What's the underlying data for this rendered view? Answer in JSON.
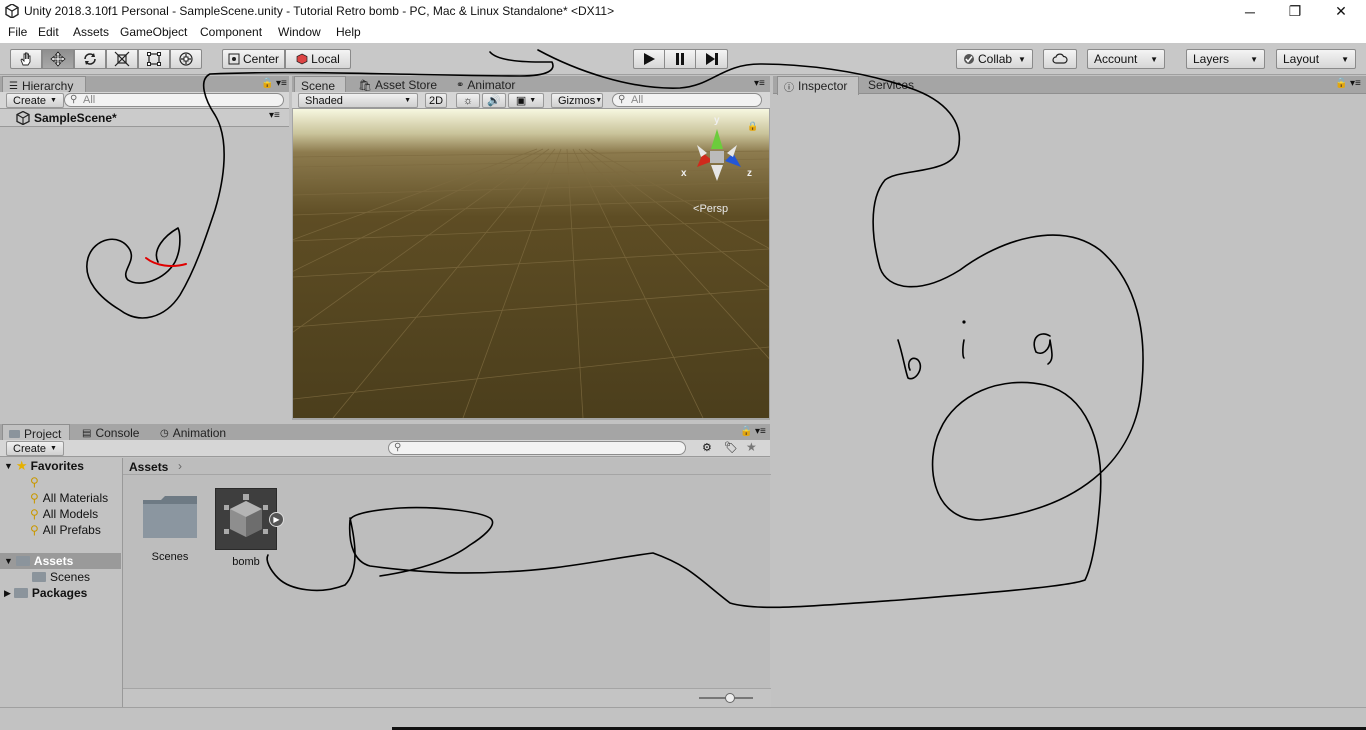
{
  "window": {
    "title": "Unity 2018.3.10f1 Personal - SampleScene.unity - Tutorial Retro bomb - PC, Mac & Linux Standalone* <DX11>",
    "minimize": "─",
    "maximize": "❐",
    "close": "✕"
  },
  "menu": [
    "File",
    "Edit",
    "Assets",
    "GameObject",
    "Component",
    "Window",
    "Help"
  ],
  "toolbar": {
    "tools": [
      "hand-tool",
      "move-tool",
      "rotate-tool",
      "scale-tool",
      "rect-tool",
      "transform-tool"
    ],
    "pivot": "Center",
    "space": "Local",
    "collab": "Collab",
    "account": "Account",
    "layers": "Layers",
    "layout": "Layout"
  },
  "hierarchy": {
    "tab": "Hierarchy",
    "create": "Create",
    "search_placeholder": "All",
    "scene": "SampleScene*"
  },
  "scene_tabs": {
    "scene": "Scene",
    "asset_store": "Asset Store",
    "animator": "Animator"
  },
  "scene_toolbar": {
    "shading": "Shaded",
    "mode_2d": "2D",
    "gizmos": "Gizmos",
    "search_placeholder": "All"
  },
  "gizmo": {
    "y": "y",
    "x": "x",
    "z": "z",
    "persp": "Persp"
  },
  "inspector": {
    "tab": "Inspector",
    "services": "Services"
  },
  "project": {
    "tabs": [
      "Project",
      "Console",
      "Animation"
    ],
    "create": "Create",
    "breadcrumb": "Assets",
    "favorites": {
      "label": "Favorites",
      "items": [
        "",
        "All Materials",
        "All Models",
        "All Prefabs"
      ]
    },
    "assets_label": "Assets",
    "scenes_label": "Scenes",
    "packages_label": "Packages",
    "grid": [
      {
        "name": "Scenes",
        "kind": "folder"
      },
      {
        "name": "bomb",
        "kind": "model"
      }
    ]
  },
  "drawing": {
    "text": "big",
    "stroke_color": "#000000",
    "accent_color": "#e00000"
  },
  "colors": {
    "panel_bg": "#c2c2c2",
    "tab_bg": "#a5a5a5",
    "gizmo_y": "#6ccc3c",
    "gizmo_x": "#d02a1c",
    "gizmo_z": "#2356d6"
  }
}
